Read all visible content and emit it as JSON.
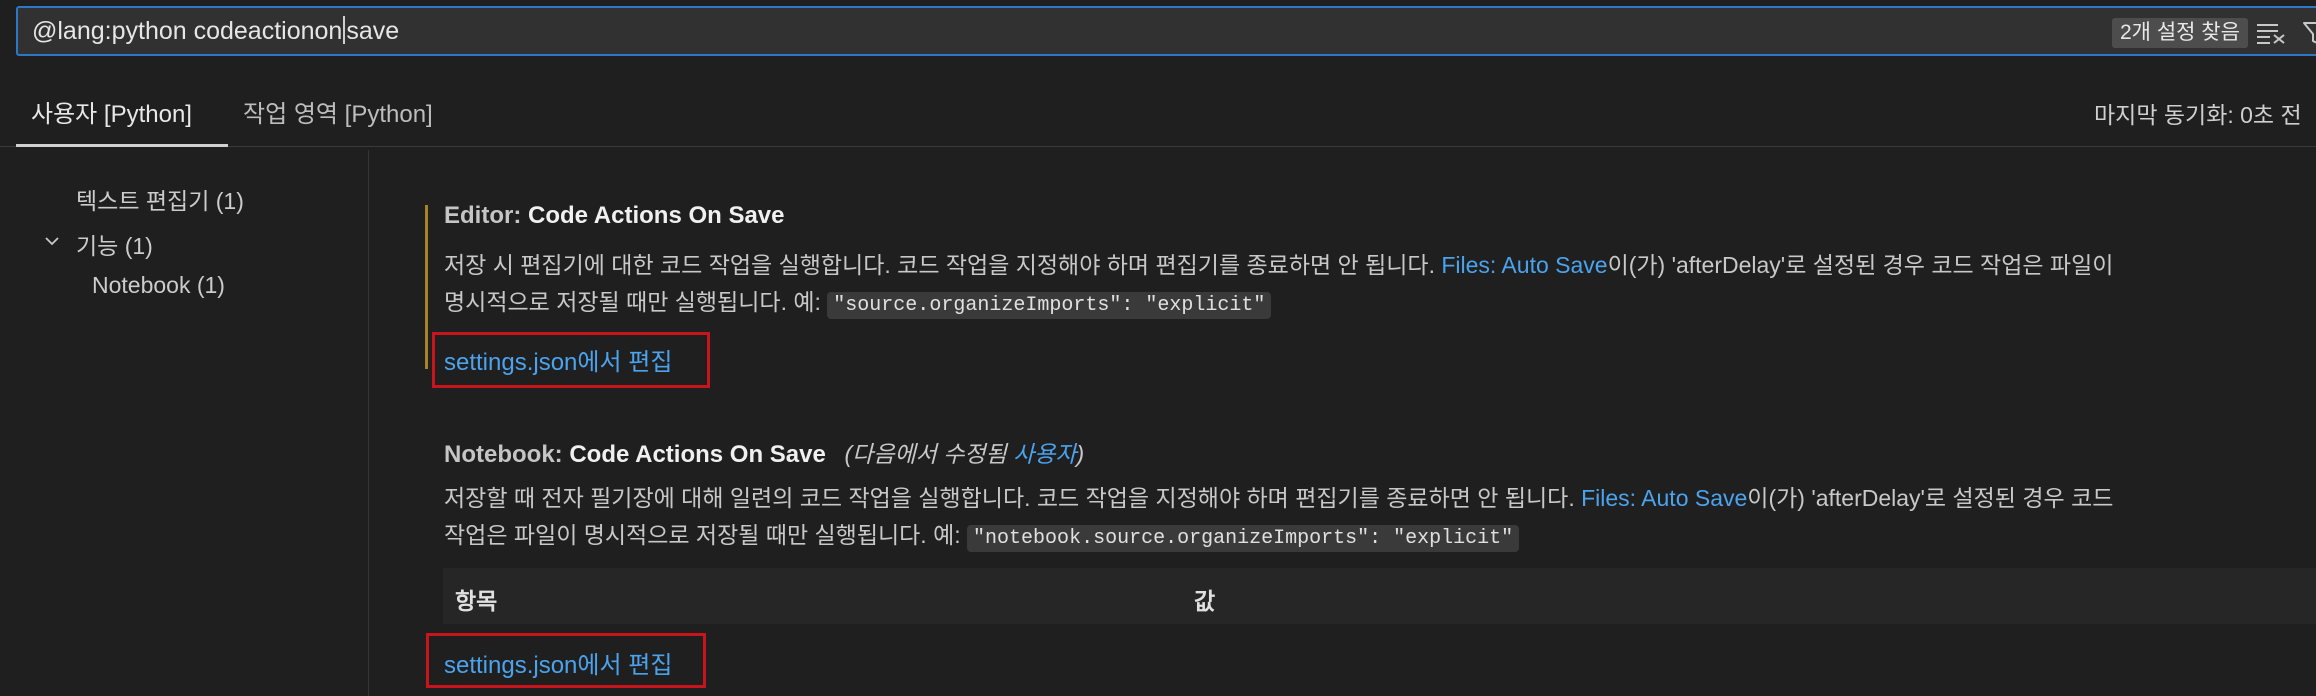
{
  "search": {
    "query_before_caret": "@lang:python codeactionon",
    "query_after_caret": "save",
    "result_count": "2개 설정 찾음"
  },
  "tabs": {
    "user": "사용자 [Python]",
    "workspace": "작업 영역 [Python]",
    "sync_status": "마지막 동기화: 0초 전"
  },
  "toc": {
    "items": [
      {
        "label": "텍스트 편집기 (1)"
      },
      {
        "label": "기능 (1)"
      },
      {
        "label": "Notebook (1)"
      }
    ]
  },
  "settings": [
    {
      "category": "Editor: ",
      "name": "Code Actions On Save",
      "desc_line1_pre": "저장 시 편집기에 대한 코드 작업을 실행합니다. 코드 작업을 지정해야 하며 편집기를 종료하면 안 됩니다. ",
      "desc_link": "Files: Auto Save",
      "desc_line1_post": "이(가) 'afterDelay'로 설정된 경우 코드 작업은 파일이",
      "desc_line2_pre": "명시적으로 저장될 때만 실행됩니다. 예: ",
      "desc_code": "\"source.organizeImports\": \"explicit\"",
      "edit_link": "settings.json에서 편집"
    },
    {
      "category": "Notebook: ",
      "name": "Code Actions On Save",
      "modified_pre": "(다음에서 수정됨 ",
      "modified_link": "사용자",
      "modified_post": ")",
      "desc_line1_pre": "저장할 때 전자 필기장에 대해 일련의 코드 작업을 실행합니다. 코드 작업을 지정해야 하며 편집기를 종료하면 안 됩니다. ",
      "desc_link": "Files: Auto Save",
      "desc_line1_post": "이(가) 'afterDelay'로 설정된 경우 코드",
      "desc_line2_pre": "작업은 파일이 명시적으로 저장될 때만 실행됩니다. 예: ",
      "desc_code": "\"notebook.source.organizeImports\": \"explicit\"",
      "table_col_item": "항목",
      "table_col_value": "값",
      "edit_link": "settings.json에서 편집"
    }
  ],
  "colors": {
    "accent_link": "#4ba3ee",
    "focus_border": "#2a78c6",
    "modified_indicator": "#a8822a",
    "highlight_box": "#c8151b"
  },
  "icons": [
    "clear-filter-icon",
    "filter-icon",
    "chevron-down-icon"
  ]
}
